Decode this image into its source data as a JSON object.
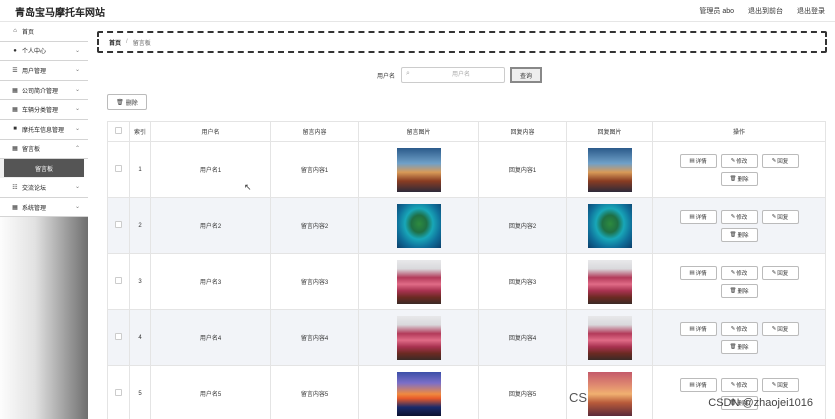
{
  "header": {
    "site_title": "青岛宝马摩托车网站",
    "admin": "管理员 abo",
    "to_front": "退出到前台",
    "logout": "退出登录"
  },
  "sidebar": {
    "items": [
      {
        "icon": "home-icon",
        "label": "首页"
      },
      {
        "icon": "user-icon",
        "label": "个人中心"
      },
      {
        "icon": "list-icon",
        "label": "用户管理"
      },
      {
        "icon": "grid-icon",
        "label": "公司简介管理"
      },
      {
        "icon": "grid-icon",
        "label": "车辆分类管理"
      },
      {
        "icon": "lock-icon",
        "label": "摩托车信息管理"
      },
      {
        "icon": "grid-icon",
        "label": "留言板"
      }
    ],
    "active_sub": "留言板",
    "items_after": [
      {
        "icon": "sliders-icon",
        "label": "交流论坛"
      },
      {
        "icon": "grid-icon",
        "label": "系统管理"
      }
    ]
  },
  "breadcrumb": {
    "home": "首页",
    "sep": "/",
    "current": "留言板"
  },
  "search": {
    "label": "用户名",
    "placeholder": "用户名",
    "button": "查询"
  },
  "toolbar": {
    "delete_label": "删除"
  },
  "table": {
    "headers": [
      "索引",
      "用户名",
      "留言内容",
      "留言图片",
      "回复内容",
      "回复图片",
      "操作"
    ],
    "rows": [
      {
        "index": "1",
        "username": "用户名1",
        "content": "留言内容1",
        "reply": "回复内容1",
        "img": "sunset"
      },
      {
        "index": "2",
        "username": "用户名2",
        "content": "留言内容2",
        "reply": "回复内容2",
        "img": "island"
      },
      {
        "index": "3",
        "username": "用户名3",
        "content": "留言内容3",
        "reply": "回复内容3",
        "img": "flower"
      },
      {
        "index": "4",
        "username": "用户名4",
        "content": "留言内容4",
        "reply": "回复内容4",
        "img": "flower"
      },
      {
        "index": "5",
        "username": "用户名5",
        "content": "留言内容5",
        "reply": "回复内容5",
        "img": "dusk"
      }
    ],
    "ops": {
      "detail": "详情",
      "edit": "修改",
      "reply": "回复",
      "delete": "删除"
    }
  },
  "watermark": "CSDN @zhaojei1016",
  "watermark_cs": "CS"
}
